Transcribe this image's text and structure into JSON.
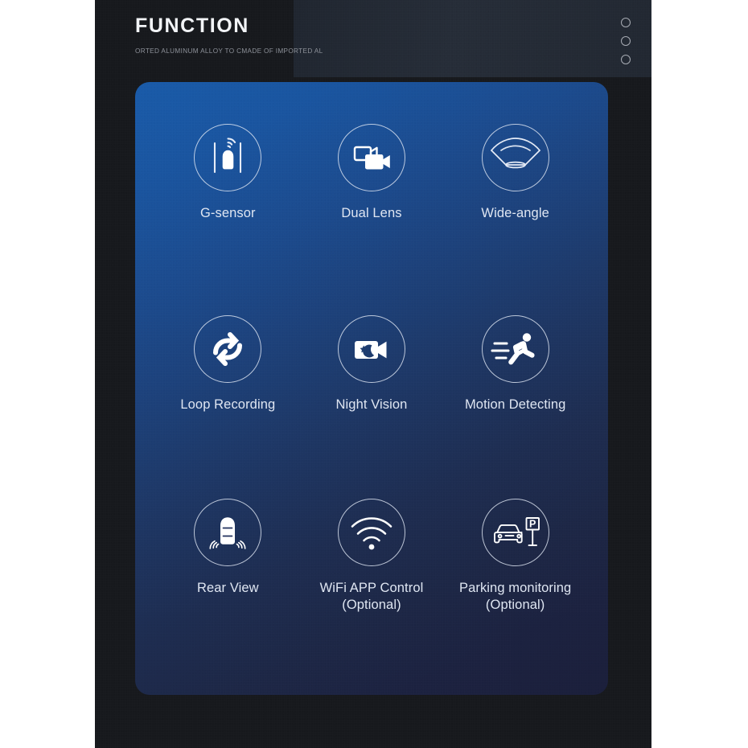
{
  "header": {
    "title": "FUNCTION",
    "subtitle": "ORTED ALUMINUM ALLOY TO CMADE OF IMPORTED AL"
  },
  "decoration": {
    "dots_count": 3,
    "dot_label": "decorative-circle"
  },
  "theme": {
    "backdrop": "#17191d",
    "panel_start": "#1a5ba9",
    "panel_end": "#1b1f3b",
    "icon_stroke": "#dfe7f3",
    "label_color": "#dfe6f2",
    "page_background": "#ffffff"
  },
  "features": [
    {
      "id": "g-sensor",
      "label": "G-sensor",
      "icon": "car-gsensor-icon"
    },
    {
      "id": "dual-lens",
      "label": "Dual Lens",
      "icon": "dual-camera-icon"
    },
    {
      "id": "wide-angle",
      "label": "Wide-angle",
      "icon": "wide-angle-lens-icon"
    },
    {
      "id": "loop-recording",
      "label": "Loop Recording",
      "icon": "loop-arrows-icon"
    },
    {
      "id": "night-vision",
      "label": "Night Vision",
      "icon": "camera-moon-star-icon"
    },
    {
      "id": "motion-detecting",
      "label": "Motion Detecting",
      "icon": "running-person-icon"
    },
    {
      "id": "rear-view",
      "label": "Rear View",
      "icon": "car-rear-waves-icon"
    },
    {
      "id": "wifi-app-control",
      "label": "WiFi APP Control\n(Optional)",
      "icon": "wifi-signal-icon"
    },
    {
      "id": "parking-monitoring",
      "label": "Parking monitoring\n(Optional)",
      "icon": "car-parking-sign-icon"
    }
  ]
}
